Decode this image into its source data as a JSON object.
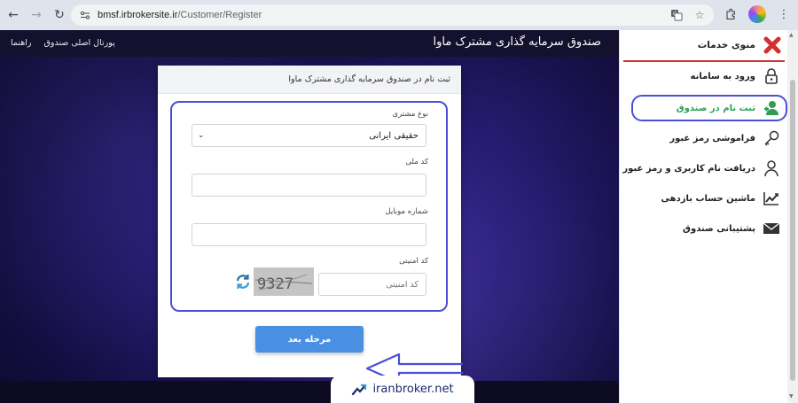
{
  "browser": {
    "url_host": "bmsf.irbrokersite.ir",
    "url_path": "/Customer/Register"
  },
  "site": {
    "brand": "صندوق سرمایه گذاری مشترک ماوا",
    "links": [
      "پورتال اصلی صندوق",
      "راهنما"
    ]
  },
  "form": {
    "title": "ثبت نام در صندوق سرمایه گذاری مشترک ماوا",
    "customer_type_label": "نوع مشتری",
    "customer_type_value": "حقیقی ایرانی",
    "national_code_label": "کد ملی",
    "mobile_label": "شماره موبایل",
    "captcha_label": "کد امنیتی",
    "captcha_placeholder": "کد امنیتی",
    "captcha_code": "9327",
    "next_button": "مرحله بعد"
  },
  "sidebar": {
    "title": "منوی خدمات",
    "items": [
      {
        "label": "ورود به سامانه",
        "icon": "lock-icon"
      },
      {
        "label": "ثبت نام در صندوق",
        "icon": "add-user-icon",
        "active": true
      },
      {
        "label": "فراموشی رمز عبور",
        "icon": "key-icon"
      },
      {
        "label": "دریافت نام کاربری و رمز عبور",
        "icon": "user-icon"
      },
      {
        "label": "ماشین حساب بازدهی",
        "icon": "chart-icon"
      },
      {
        "label": "پشتیبانی صندوق",
        "icon": "envelope-icon"
      }
    ]
  },
  "watermark": {
    "text": "iranbroker.net"
  },
  "colors": {
    "accent_blue": "#4a90e2",
    "highlight": "#4a4fd6",
    "active_green": "#2e9e57",
    "close_red": "#d32f2f"
  }
}
